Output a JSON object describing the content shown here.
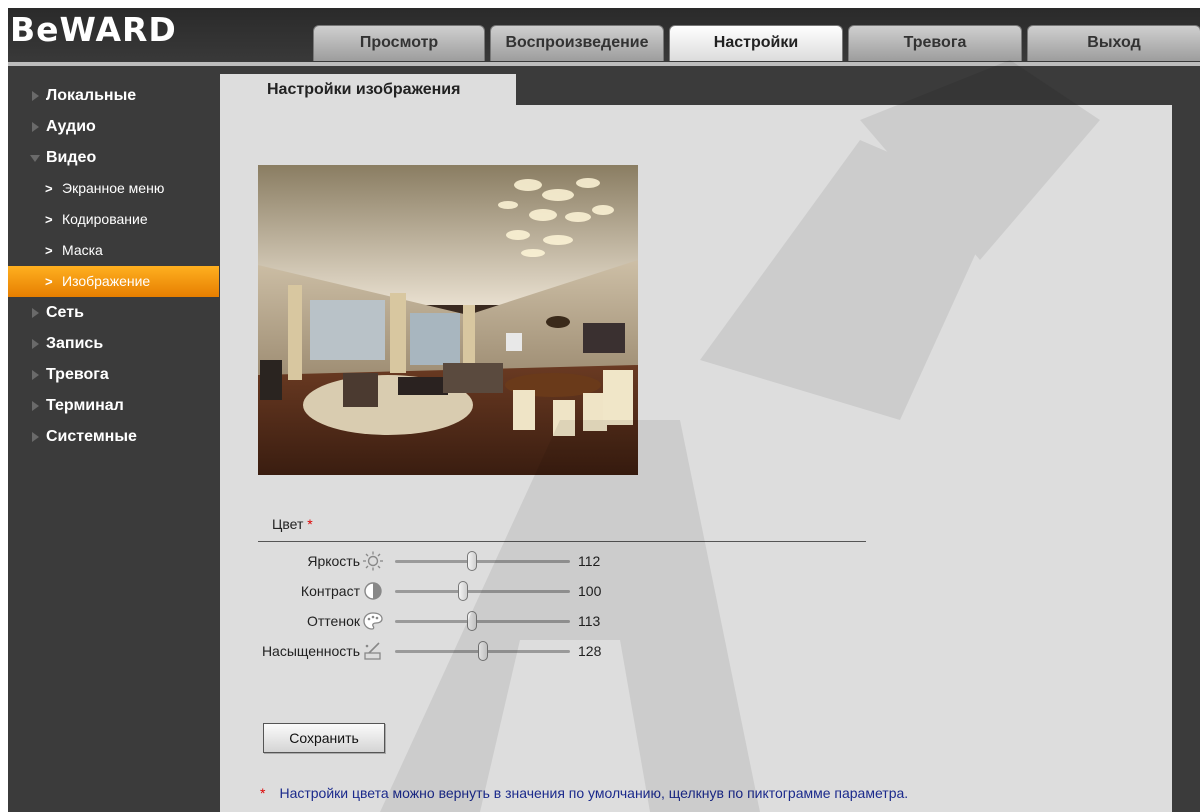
{
  "brand": "BeWARD",
  "nav_tabs": [
    {
      "label": "Просмотр"
    },
    {
      "label": "Воспроизведение"
    },
    {
      "label": "Настройки"
    },
    {
      "label": "Тревога"
    },
    {
      "label": "Выход"
    }
  ],
  "active_tab": "Настройки",
  "sidebar": {
    "items": [
      {
        "label": "Локальные"
      },
      {
        "label": "Аудио"
      },
      {
        "label": "Видео"
      },
      {
        "label": "Сеть"
      },
      {
        "label": "Запись"
      },
      {
        "label": "Тревога"
      },
      {
        "label": "Терминал"
      },
      {
        "label": "Системные"
      }
    ],
    "video_sub": [
      {
        "label": "Экранное меню"
      },
      {
        "label": "Кодирование"
      },
      {
        "label": "Маска"
      },
      {
        "label": "Изображение"
      }
    ],
    "active_sub": "Изображение"
  },
  "page": {
    "title": "Настройки изображения",
    "color_section": "Цвет",
    "required_mark": "*",
    "sliders": [
      {
        "label": "Яркость",
        "value": "112",
        "level": 0.44,
        "icon": "brightness-icon"
      },
      {
        "label": "Контраст",
        "value": "100",
        "level": 0.39,
        "icon": "contrast-icon"
      },
      {
        "label": "Оттенок",
        "value": "113",
        "level": 0.44,
        "icon": "palette-icon"
      },
      {
        "label": "Насыщенность",
        "value": "128",
        "level": 0.5,
        "icon": "saturation-icon"
      }
    ],
    "save_label": "Сохранить",
    "note_mark": "*",
    "note": "Настройки цвета можно вернуть в значения по умолчанию, щелкнув по пиктограмме параметра."
  },
  "colors": {
    "accent_orange": "#f39200",
    "background_dark": "#3b3b3b",
    "panel": "#dddddd",
    "note_text": "#1b2a8c"
  }
}
